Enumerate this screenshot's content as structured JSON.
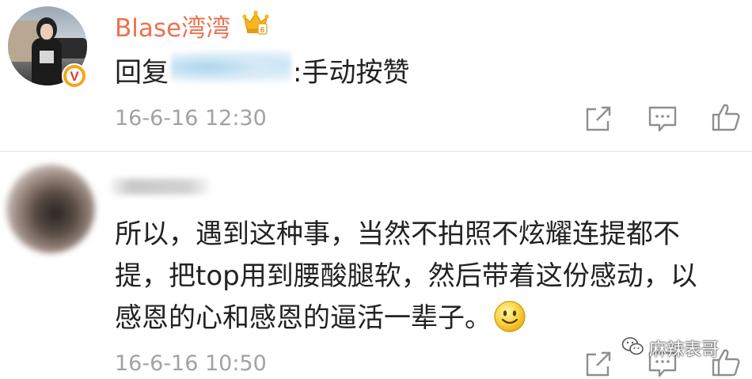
{
  "comment1": {
    "username": "Blase湾湾",
    "reply_prefix": "回复",
    "reply_text": ":手动按赞",
    "timestamp": "16-6-16 12:30",
    "actions": [
      "share-icon",
      "comment-icon",
      "like-icon"
    ],
    "colors": {
      "username": "#eb7350",
      "verified_badge": "#f2a81d"
    }
  },
  "comment2": {
    "lines": [
      "所以，遇到这种事，当然不拍照不炫耀连提都不",
      "提，把top用到腰酸腿软，然后带着这份感动，以",
      "感恩的心和感恩的逼活一辈子。"
    ],
    "timestamp": "16-6-16 10:50",
    "actions": [
      "share-icon",
      "comment-icon",
      "like-icon"
    ]
  },
  "watermark": {
    "text": "麻辣表哥"
  },
  "badge": {
    "verified_letter": "V"
  }
}
